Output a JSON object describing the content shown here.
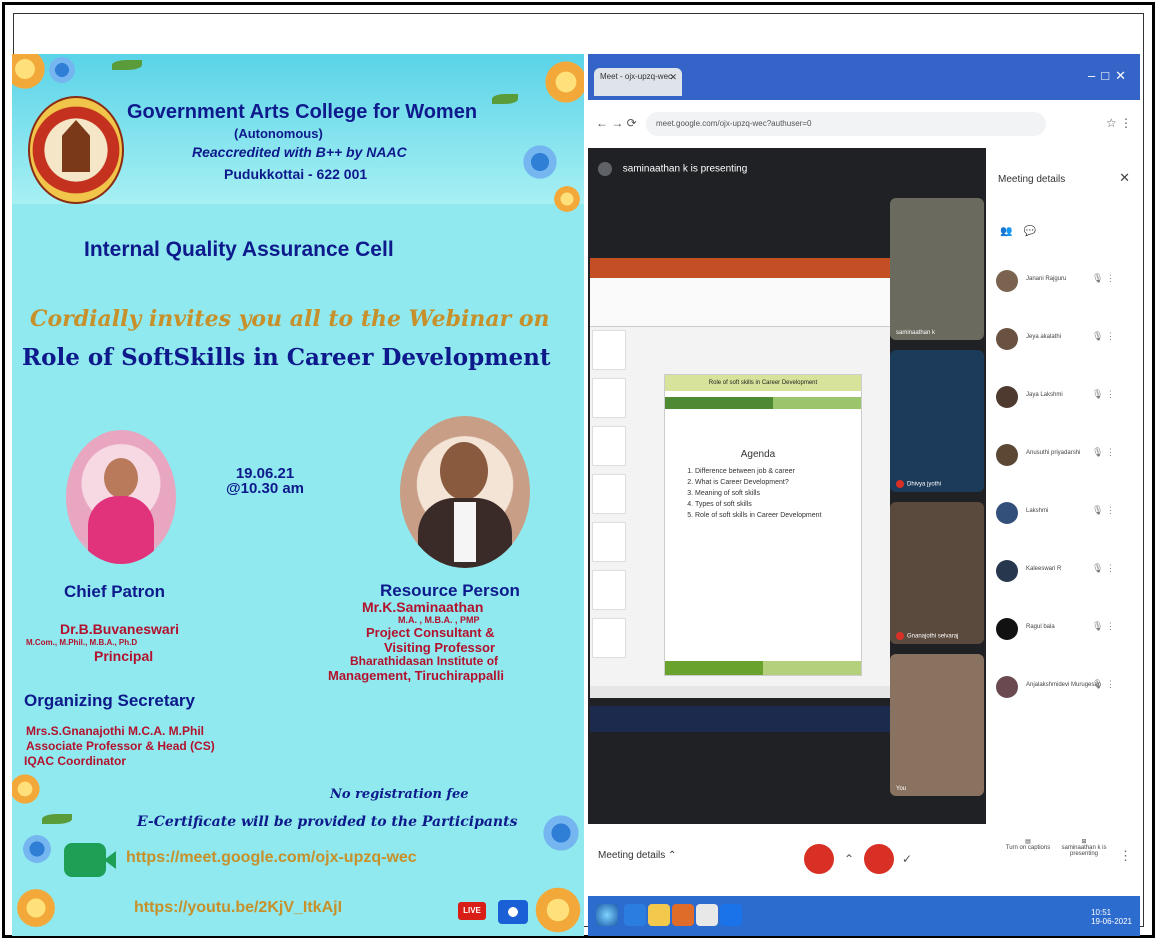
{
  "poster": {
    "college": "Government Arts College for Women",
    "autonomous": "(Autonomous)",
    "reaccredited": "Reaccredited with B++ by NAAC",
    "location": "Pudukkottai - 622 001",
    "cell": "Internal Quality Assurance Cell",
    "invite": "Cordially invites you all to the Webinar on",
    "topic": "Role of SoftSkills in Career Development",
    "date": "19.06.21",
    "time": "@10.30 am",
    "chief_patron_heading": "Chief Patron",
    "chief_patron_name": "Dr.B.Buvaneswari",
    "chief_patron_degrees": "M.Com., M.Phil., M.B.A., Ph.D",
    "chief_patron_role": "Principal",
    "org_secretary_heading": "Organizing Secretary",
    "org_secretary_name": "Mrs.S.Gnanajothi M.C.A. M.Phil",
    "org_secretary_role": "Associate Professor & Head (CS)",
    "org_secretary_role2": "IQAC Coordinator",
    "resource_heading": "Resource  Person",
    "resource_name": "Mr.K.Saminaathan",
    "resource_degrees": "M.A. , M.B.A. , PMP",
    "resource_role1": "Project Consultant &",
    "resource_role2": "Visiting Professor",
    "resource_inst1": "Bharathidasan Institute of",
    "resource_inst2": "Management, Tiruchirappalli",
    "no_fee": "No registration fee",
    "certificate": "E-Certificate will be provided to the Participants",
    "meet_link": "https://meet.google.com/ojx-upzq-wec",
    "youtube_link": "https://youtu.be/2KjV_ItkAjI",
    "live_badge": "LIVE"
  },
  "browser": {
    "tab_title": "Meet - ojx-upzq-wec",
    "url": "meet.google.com/ojx-upzq-wec?authuser=0",
    "presenting": "saminaathan k is presenting"
  },
  "slide": {
    "title": "Role of soft skills in Career Development",
    "agenda_heading": "Agenda",
    "agenda_items": [
      "Difference between job & career",
      "What is Career Development?",
      "Meaning of soft skills",
      "Types of soft skills",
      "Role of soft skills in Career Development"
    ]
  },
  "tiles": [
    "saminaathan k",
    "Dhivya jyothi",
    "Gnanajothi selvaraj",
    "You"
  ],
  "panel": {
    "title": "Meeting details",
    "people": [
      "Janani Rajguru",
      "Jeya akalathi",
      "Jaya Lakshmi",
      "Anusuthi priyadarshi",
      "Lakshmi",
      "Kaleeswari R",
      "Ragul bala",
      "Anjalakshmidevi Murugesan"
    ]
  },
  "bottom": {
    "meeting_details": "Meeting details",
    "captions": "Turn on captions",
    "presenting": "saminaathan k is presenting"
  },
  "taskbar": {
    "time": "10:51",
    "date": "19-06-2021"
  }
}
